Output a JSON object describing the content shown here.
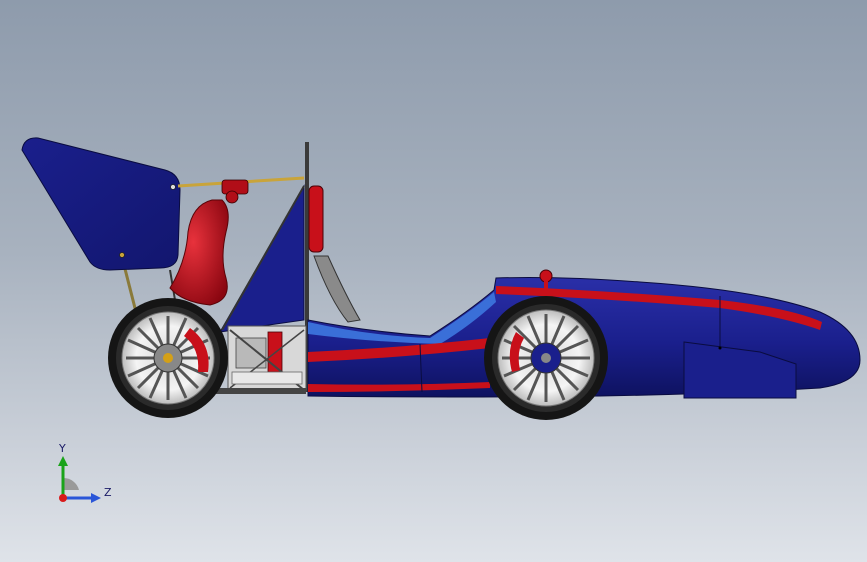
{
  "triad": {
    "y_label": "Y",
    "z_label": "Z"
  },
  "colors": {
    "body_blue": "#1a1f8c",
    "stripe_red": "#c8101a",
    "accent_light_blue": "#3a6fd8",
    "wheel_white": "#f2f2f2",
    "tire_black": "#151515",
    "gold_rod": "#c9a43a"
  }
}
